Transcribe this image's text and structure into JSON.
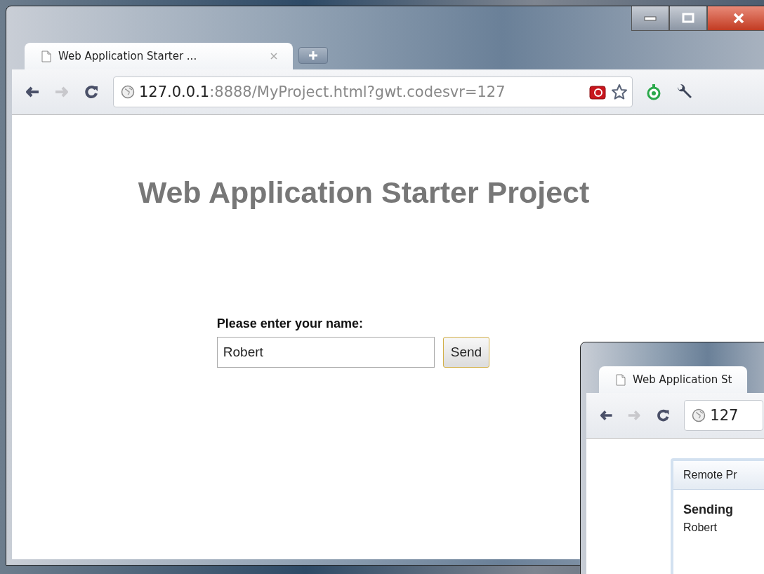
{
  "main_window": {
    "tab": {
      "title": "Web Application Starter ..."
    },
    "toolbar": {
      "url_host": "127.0.0.1",
      "url_rest": ":8888/MyProject.html?gwt.codesvr=127"
    },
    "page": {
      "heading": "Web Application Starter Project",
      "name_label": "Please enter your name:",
      "name_input": {
        "value": "Robert"
      },
      "send_button": "Send"
    }
  },
  "second_window": {
    "tab": {
      "title": "Web Application St"
    },
    "url_host": "127",
    "dialog": {
      "title": "Remote Pr",
      "sending_label": "Sending",
      "sent_name": "Robert"
    }
  }
}
